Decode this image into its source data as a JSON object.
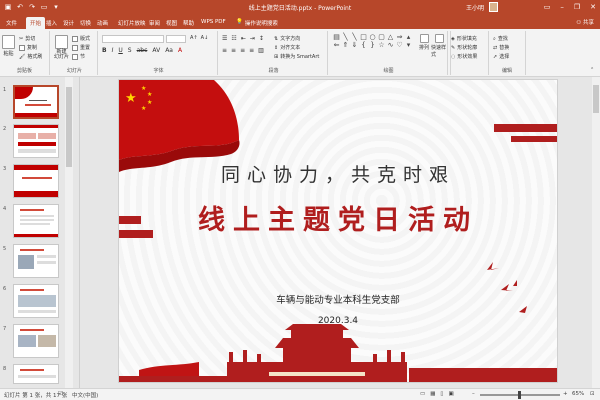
{
  "titlebar": {
    "doc_title": "线上主题党日活动.pptx - PowerPoint",
    "user_name": "王小明"
  },
  "tabs": [
    {
      "label": "文件"
    },
    {
      "label": "开始"
    },
    {
      "label": "插入"
    },
    {
      "label": "设计"
    },
    {
      "label": "切换"
    },
    {
      "label": "动画"
    },
    {
      "label": "幻灯片放映"
    },
    {
      "label": "审阅"
    },
    {
      "label": "视图"
    },
    {
      "label": "帮助"
    },
    {
      "label": "WPS PDF"
    },
    {
      "label": "操作说明搜索"
    }
  ],
  "share_label": "共享",
  "ribbon": {
    "clipboard": {
      "paste": "粘贴",
      "cut": "剪切",
      "copy": "复制",
      "format_painter": "格式刷",
      "label": "剪贴板"
    },
    "slides": {
      "new_slide": "新建\n幻灯片",
      "layout": "版式",
      "reset": "重置",
      "section": "节",
      "label": "幻灯片"
    },
    "font": {
      "label": "字体"
    },
    "paragraph": {
      "text_direction": "文字方向",
      "align_text": "对齐文本",
      "smartart": "转换为 SmartArt",
      "label": "段落"
    },
    "drawing": {
      "arrange": "排列",
      "quick_styles": "快速样式",
      "shape_fill": "形状填充",
      "shape_outline": "形状轮廓",
      "shape_effects": "形状效果",
      "label": "绘图"
    },
    "editing": {
      "find": "查找",
      "replace": "替换",
      "select": "选择",
      "label": "编辑"
    }
  },
  "thumbnails": [
    {
      "num": "1"
    },
    {
      "num": "2"
    },
    {
      "num": "3"
    },
    {
      "num": "4"
    },
    {
      "num": "5"
    },
    {
      "num": "6"
    },
    {
      "num": "7"
    },
    {
      "num": "8"
    }
  ],
  "slide": {
    "subtitle": "同心协力，共克时艰",
    "title": "线上主题党日活动",
    "org": "车辆与能动专业本科生党支部",
    "date": "2020.3.4"
  },
  "status": {
    "slide_count": "幻灯片 第 1 张，共 17 张",
    "language": "中文(中国)",
    "zoom": "65%"
  },
  "colors": {
    "accent": "#b7472a",
    "slide_red": "#b01e1e"
  }
}
